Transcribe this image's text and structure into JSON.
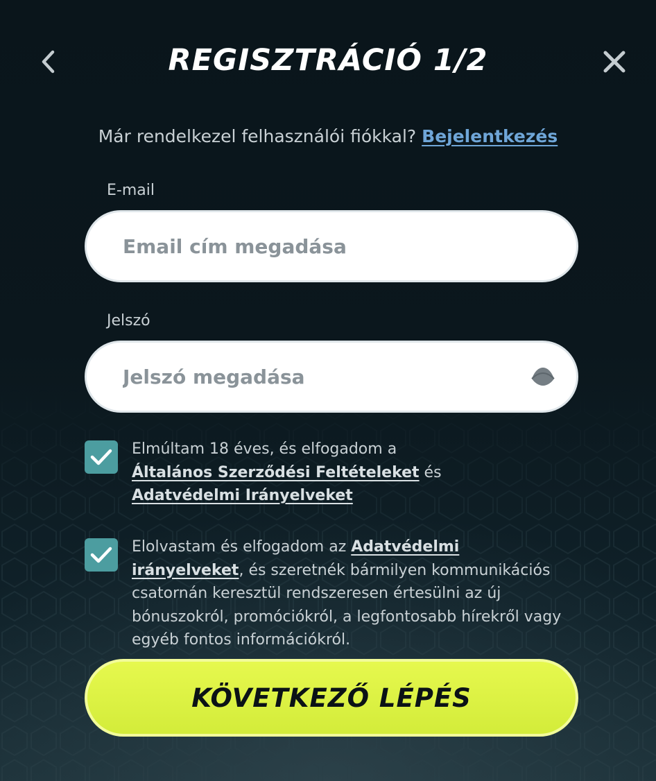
{
  "header": {
    "title": "REGISZTRÁCIÓ 1/2",
    "back_icon": "chevron-left-icon",
    "close_icon": "close-icon"
  },
  "login_prompt": {
    "text": "Már rendelkezel felhasználói fiókkal? ",
    "link": "Bejelentkezés"
  },
  "email": {
    "label": "E-mail",
    "placeholder": "Email cím megadása",
    "value": ""
  },
  "password": {
    "label": "Jelszó",
    "placeholder": "Jelszó megadása",
    "value": "",
    "toggle_icon": "eye-icon"
  },
  "consent_terms": {
    "checked": true,
    "text_1": "Elmúltam 18 éves, és elfogadom a ",
    "link_1": "Általános Szerződési Feltételeket",
    "text_2": " és ",
    "link_2": "Adatvédelmi Irányelveket"
  },
  "consent_marketing": {
    "checked": true,
    "text_1": "Elolvastam és elfogadom az ",
    "link_1": "Adatvédelmi irányelveket",
    "text_2": ", és szeretnék bármilyen kommunikációs csatornán keresztül rendszeresen értesülni az új bónuszokról, promóciókról, a legfontosabb hírekről vagy egyéb fontos információkról."
  },
  "next_button": {
    "label": "KÖVETKEZŐ LÉPÉS"
  },
  "colors": {
    "background": "#0b171d",
    "accent_button": "#dff345",
    "checkbox": "#4c9da0",
    "link": "#6fa6d8"
  }
}
